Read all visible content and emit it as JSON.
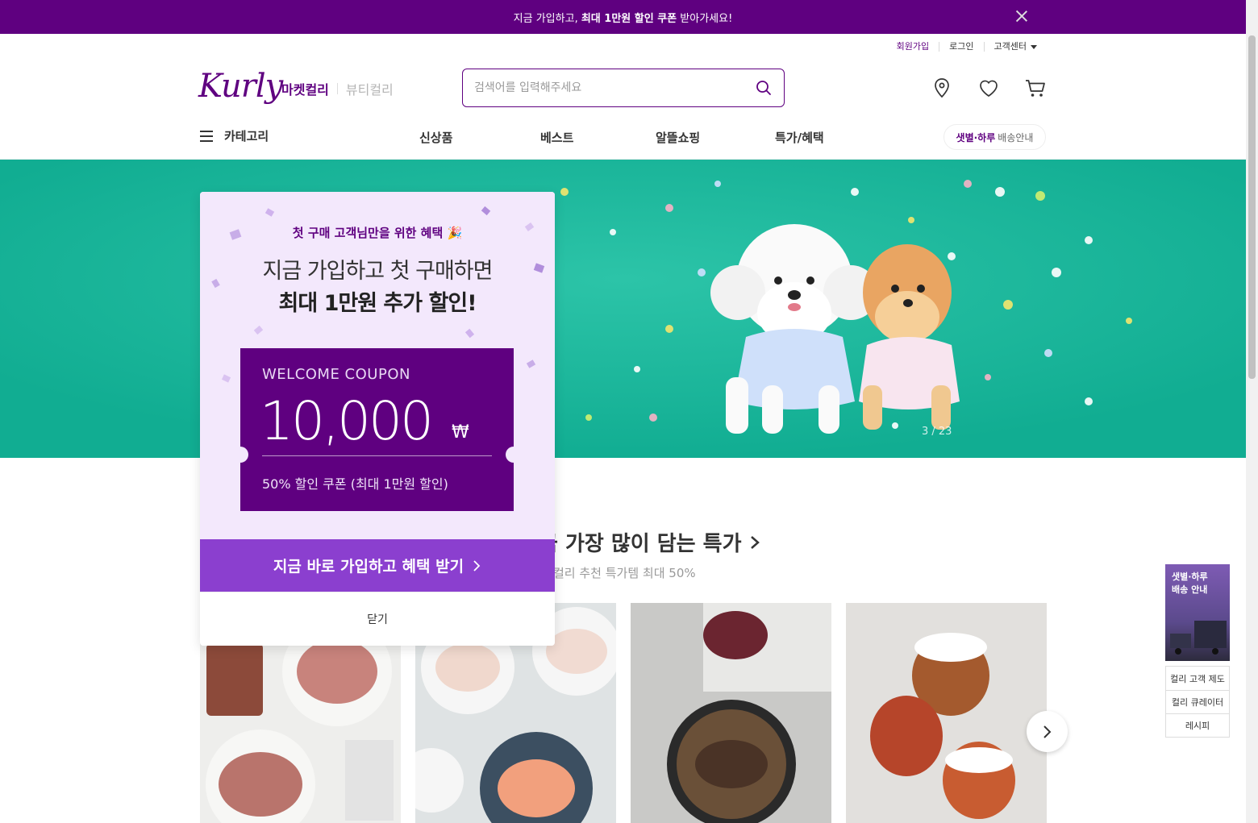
{
  "top_banner": {
    "prefix": "지금 가입하고,",
    "highlight": "최대 1만원 할인 쿠폰",
    "suffix": "받아가세요!"
  },
  "user_menu": {
    "signup": "회원가입",
    "login": "로그인",
    "customer_center": "고객센터"
  },
  "header": {
    "logo": "Kurly",
    "tab_market": "마켓컬리",
    "tab_beauty": "뷰티컬리",
    "search_placeholder": "검색어를 입력해주세요",
    "icons": [
      "location-icon",
      "heart-icon",
      "cart-icon"
    ]
  },
  "gnb": {
    "category": "카테고리",
    "menus": [
      "신상품",
      "베스트",
      "알뜰쇼핑",
      "특가/혜택"
    ],
    "delivery_bold": "샛별·하루",
    "delivery_rest": "배송안내"
  },
  "hero": {
    "counter": "3 / 23",
    "bg_color": "#11ad92"
  },
  "section": {
    "title": "금 가장 많이 담는 특가",
    "subtitle": "컬리 추천 특가템 최대 50%"
  },
  "side_menu": {
    "banner_text": "샛별·하루\n배송 안내",
    "links": [
      "컬리 고객 제도",
      "컬리 큐레이터",
      "레시피"
    ]
  },
  "popup": {
    "eyebrow": "첫 구매 고객님만을 위한 혜택 🎉",
    "line1": "지금 가입하고 첫 구매하면",
    "line2": "최대 1만원 추가 할인!",
    "coupon_label": "WELCOME COUPON",
    "coupon_amount": "10,000",
    "coupon_unit": "₩",
    "coupon_desc": "50% 할인 쿠폰 (최대 1만원 할인)",
    "cta": "지금 바로 가입하고 혜택 받기",
    "close": "닫기"
  },
  "colors": {
    "brand": "#5f0080",
    "cta": "#8b3fcf",
    "popup_bg": "#f3e8fc"
  }
}
